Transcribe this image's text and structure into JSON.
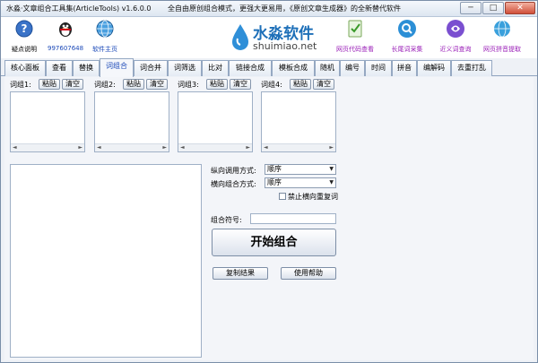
{
  "window": {
    "title": "水淼·文章组合工具集(ArticleTools) v1.6.0.0",
    "slogan": "全自由原创组合模式，更强大更易用，《原创文章生成器》的全新替代软件",
    "minimize": "─",
    "maximize": "□",
    "close": "✕"
  },
  "toolbar": {
    "help": "疑点说明",
    "qq": "997607648",
    "homepage": "软件主页",
    "brand_name": "水淼软件",
    "brand_url": "shuimiao.net",
    "page_code": "网页代码查看",
    "longtail": "长尾词采集",
    "synonym": "近义词查询",
    "pinyin": "网页拼音提取"
  },
  "tabs": [
    "核心面板",
    "查看",
    "替换",
    "词组合",
    "词合并",
    "词筛选",
    "比对",
    "链接合成",
    "模板合成",
    "随机",
    "编号",
    "时间",
    "拼音",
    "编解码",
    "去重打乱"
  ],
  "active_tab_index": 3,
  "groups": [
    {
      "label": "词组1:",
      "paste": "粘贴",
      "clear": "清空"
    },
    {
      "label": "词组2:",
      "paste": "粘贴",
      "clear": "清空"
    },
    {
      "label": "词组3:",
      "paste": "粘贴",
      "clear": "清空"
    },
    {
      "label": "词组4:",
      "paste": "粘贴",
      "clear": "清空"
    }
  ],
  "options": {
    "vertical_label": "纵向调用方式:",
    "vertical_value": "顺序",
    "horizontal_label": "横向组合方式:",
    "horizontal_value": "顺序",
    "no_repeat": "禁止横向重复词",
    "symbol_label": "组合符号:",
    "start": "开始组合",
    "copy_result": "复制结果",
    "use_help": "使用帮助"
  },
  "colors": {
    "brand_blue": "#1d6fb8",
    "link_blue": "#1b49b8",
    "link_purple": "#9b21b8"
  }
}
